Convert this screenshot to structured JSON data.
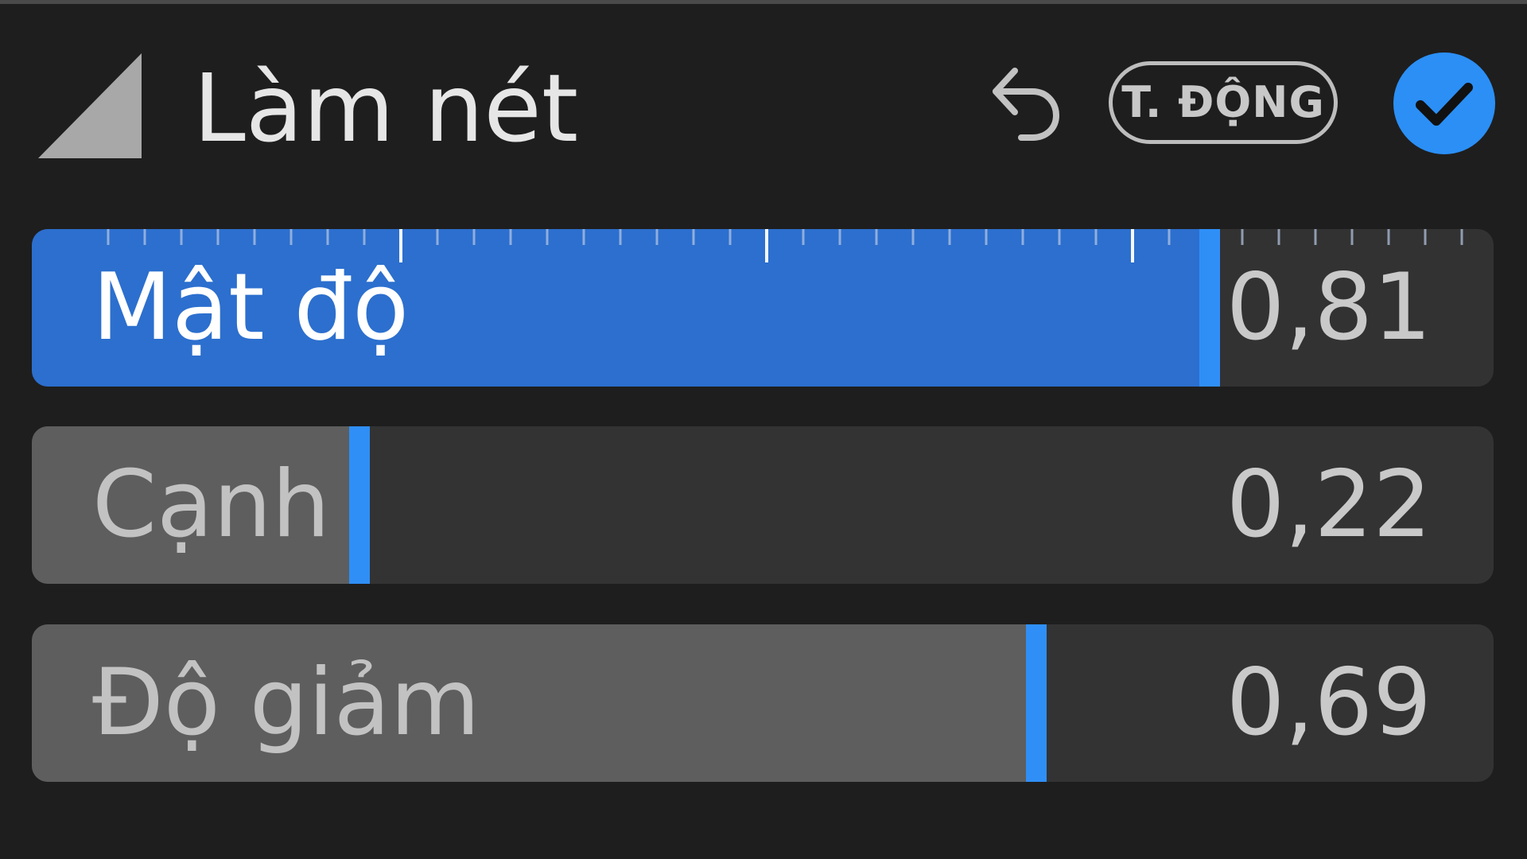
{
  "panel": {
    "title": "Làm nét",
    "auto_label": "T. ĐỘNG",
    "accent_color": "#2b8ff6"
  },
  "icons": {
    "disclosure": "disclosure-triangle-icon",
    "reset": "undo-arrow-icon",
    "enabled": "checkmark-icon"
  },
  "sliders": [
    {
      "label": "Mật độ",
      "value": "0,81",
      "level": 0.81,
      "selected": true
    },
    {
      "label": "Cạnh",
      "value": "0,22",
      "level": 0.22,
      "selected": false
    },
    {
      "label": "Độ giảm",
      "value": "0,69",
      "level": 0.69,
      "selected": false
    }
  ]
}
